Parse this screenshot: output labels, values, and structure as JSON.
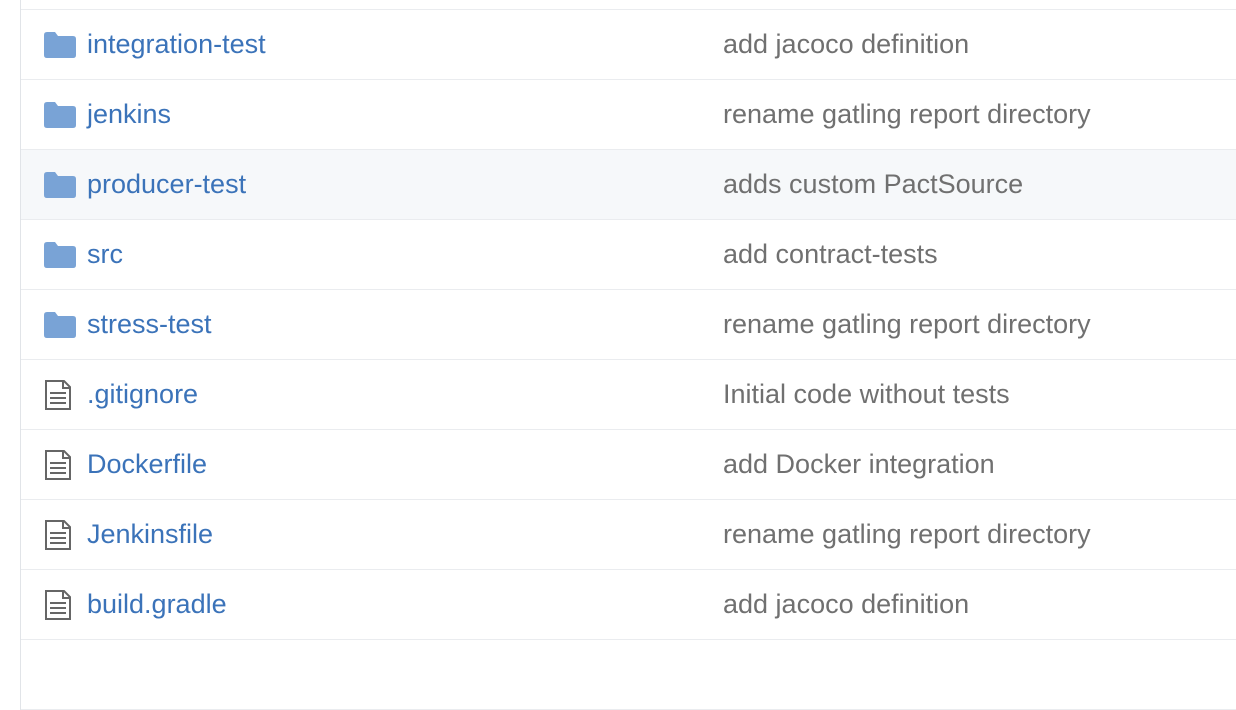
{
  "colors": {
    "link": "#3b73b9",
    "message": "#707070",
    "folder_icon": "#79a3d6",
    "file_icon": "#666666",
    "hover_row": "#f6f8fa"
  },
  "files": [
    {
      "name": "",
      "message": "",
      "type": "folder",
      "icon": "folder-icon"
    },
    {
      "name": "integration-test",
      "message": "add jacoco definition",
      "type": "folder",
      "icon": "folder-icon"
    },
    {
      "name": "jenkins",
      "message": "rename gatling report directory",
      "type": "folder",
      "icon": "folder-icon"
    },
    {
      "name": "producer-test",
      "message": "adds custom PactSource",
      "type": "folder",
      "icon": "folder-icon",
      "hovered": true
    },
    {
      "name": "src",
      "message": "add contract-tests",
      "type": "folder",
      "icon": "folder-icon"
    },
    {
      "name": "stress-test",
      "message": "rename gatling report directory",
      "type": "folder",
      "icon": "folder-icon"
    },
    {
      "name": ".gitignore",
      "message": "Initial code without tests",
      "type": "file",
      "icon": "file-text-icon"
    },
    {
      "name": "Dockerfile",
      "message": "add Docker integration",
      "type": "file",
      "icon": "file-text-icon"
    },
    {
      "name": "Jenkinsfile",
      "message": "rename gatling report directory",
      "type": "file",
      "icon": "file-text-icon"
    },
    {
      "name": "build.gradle",
      "message": "add jacoco definition",
      "type": "file",
      "icon": "file-text-icon"
    },
    {
      "name": "",
      "message": "",
      "type": "file",
      "icon": "file-text-icon"
    }
  ]
}
